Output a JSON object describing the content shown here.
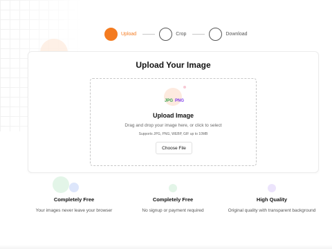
{
  "stepper": {
    "steps": [
      {
        "label": "Upload"
      },
      {
        "label": "Crop"
      },
      {
        "label": "Download"
      }
    ]
  },
  "upload_card": {
    "title": "Upload Your Image",
    "dropzone": {
      "badges": [
        "JPG",
        "PNG"
      ],
      "heading": "Upload Image",
      "instruction": "Drag and drop your image here, or click to select",
      "support_text": "Supports JPG, PNG, WEBP, GIF up to 10MB",
      "button_label": "Choose File"
    }
  },
  "features": [
    {
      "title": "Completely Free",
      "description": "Your images never leave your browser"
    },
    {
      "title": "Completely Free",
      "description": "No signup or payment required"
    },
    {
      "title": "High Quality",
      "description": "Original quality with transparent background"
    }
  ],
  "colors": {
    "accent": "#f47b20",
    "jpg_badge": "#2ea04a",
    "png_badge": "#7c3aed"
  }
}
